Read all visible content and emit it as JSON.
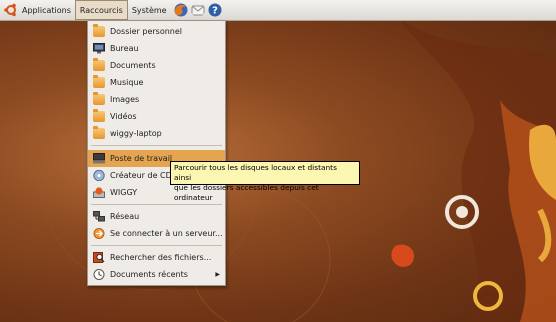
{
  "panel": {
    "applications_label": "Applications",
    "places_label": "Raccourcis",
    "system_label": "Système",
    "launchers": [
      "firefox-icon",
      "mail-icon",
      "help-icon"
    ]
  },
  "menu": {
    "items": [
      {
        "label": "Dossier personnel",
        "icon": "home-folder-icon"
      },
      {
        "label": "Bureau",
        "icon": "desktop-icon"
      },
      {
        "label": "Documents",
        "icon": "folder-icon"
      },
      {
        "label": "Musique",
        "icon": "folder-icon"
      },
      {
        "label": "Images",
        "icon": "folder-icon"
      },
      {
        "label": "Vidéos",
        "icon": "folder-icon"
      },
      {
        "label": "wiggy-laptop",
        "icon": "folder-icon"
      },
      {
        "label": "Poste de travail",
        "icon": "computer-icon",
        "highlighted": true
      },
      {
        "label": "Créateur de CD/DVD",
        "icon": "cd-icon"
      },
      {
        "label": "WIGGY",
        "icon": "drive-icon"
      },
      {
        "label": "Réseau",
        "icon": "network-icon"
      },
      {
        "label": "Se connecter à un serveur...",
        "icon": "connect-server-icon"
      },
      {
        "label": "Rechercher des fichiers...",
        "icon": "search-icon"
      },
      {
        "label": "Documents récents",
        "icon": "recent-icon",
        "submenu": true
      }
    ]
  },
  "tooltip": {
    "line1": "Parcourir tous les disques locaux et distants ainsi",
    "line2": "que les dossiers accessibles depuis cet ordinateur"
  },
  "colors": {
    "highlight": "#e5a44f",
    "menu_bg": "#efebe7",
    "tooltip_bg": "#fbf6b2",
    "wallpaper": "#8c4a21"
  }
}
